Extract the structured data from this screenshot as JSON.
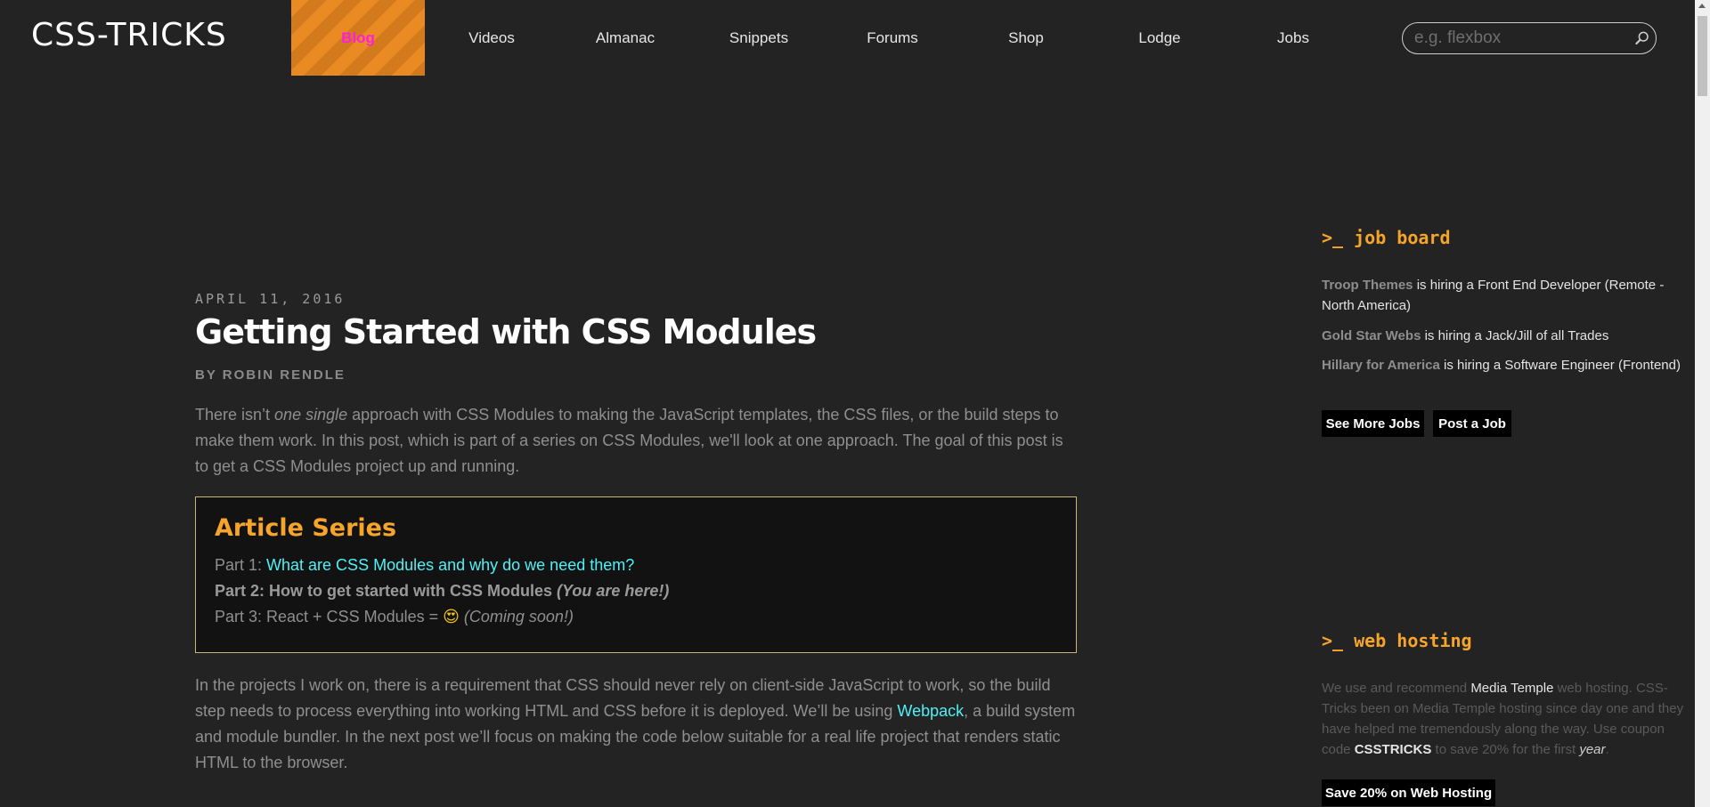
{
  "header": {
    "logo": "CSS-TRICKS",
    "nav": [
      {
        "label": "Blog",
        "active": true
      },
      {
        "label": "Videos"
      },
      {
        "label": "Almanac"
      },
      {
        "label": "Snippets"
      },
      {
        "label": "Forums"
      },
      {
        "label": "Shop"
      },
      {
        "label": "Lodge"
      },
      {
        "label": "Jobs"
      }
    ],
    "search_placeholder": "e.g. flexbox",
    "search_icon": "search-icon"
  },
  "article": {
    "date": "APRIL 11, 2016",
    "title": "Getting Started with CSS Modules",
    "byline": "BY ROBIN RENDLE",
    "intro": {
      "before": "There isn’t ",
      "em": "one single",
      "after": " approach with CSS Modules to making the JavaScript templates, the CSS files, or the build steps to make them work. In this post, which is part of a series on CSS Modules, we'll look at one approach. The goal of this post is to get a CSS Modules project up and running."
    },
    "series": {
      "heading": "Article Series",
      "part1_prefix": "Part 1: ",
      "part1_link": "What are CSS Modules and why do we need them?",
      "part2_bold": "Part 2: How to get started with CSS Modules",
      "part2_note": " (You are here!)",
      "part3_prefix": "Part 3: React + CSS Modules = ",
      "part3_emoji": "😍",
      "part3_note": " (Coming soon!)"
    },
    "para2": {
      "before": "In the projects I work on, there is a requirement that CSS should never rely on client-side JavaScript to work, so the build step needs to process everything into working HTML and CSS before it is deployed. We’ll be using ",
      "link": "Webpack",
      "after": ", a build system and module bundler. In the next post we’ll focus on making the code below suitable for a real life project that renders static HTML to the browser."
    }
  },
  "sidebar": {
    "job_board_heading": ">_ job board",
    "jobs": [
      {
        "company": "Troop Themes",
        "text": " is hiring a Front End Developer (Remote - North America)"
      },
      {
        "company": "Gold Star Webs",
        "text": " is hiring a Jack/Jill of all Trades"
      },
      {
        "company": "Hillary for America",
        "text": " is hiring a Software Engineer (Frontend)"
      }
    ],
    "see_more_jobs": "See More Jobs",
    "post_a_job": "Post a Job",
    "web_hosting_heading": ">_ web hosting",
    "hosting": {
      "t1": "We use and recommend ",
      "media_temple": "Media Temple",
      "t2": " web hosting. CSS-Tricks been on Media Temple hosting since day one and they have helped me tremendously along the way. Use coupon code ",
      "code": "CSSTRICKS",
      "t3": " to save 20% for the first ",
      "year": "year",
      "t4": "."
    },
    "save_button": "Save 20% on Web Hosting"
  },
  "colors": {
    "background": "#232323",
    "accent_orange": "#f7a52a",
    "link_cyan": "#4ef1f6",
    "active_nav_text": "#ff1ee1"
  }
}
